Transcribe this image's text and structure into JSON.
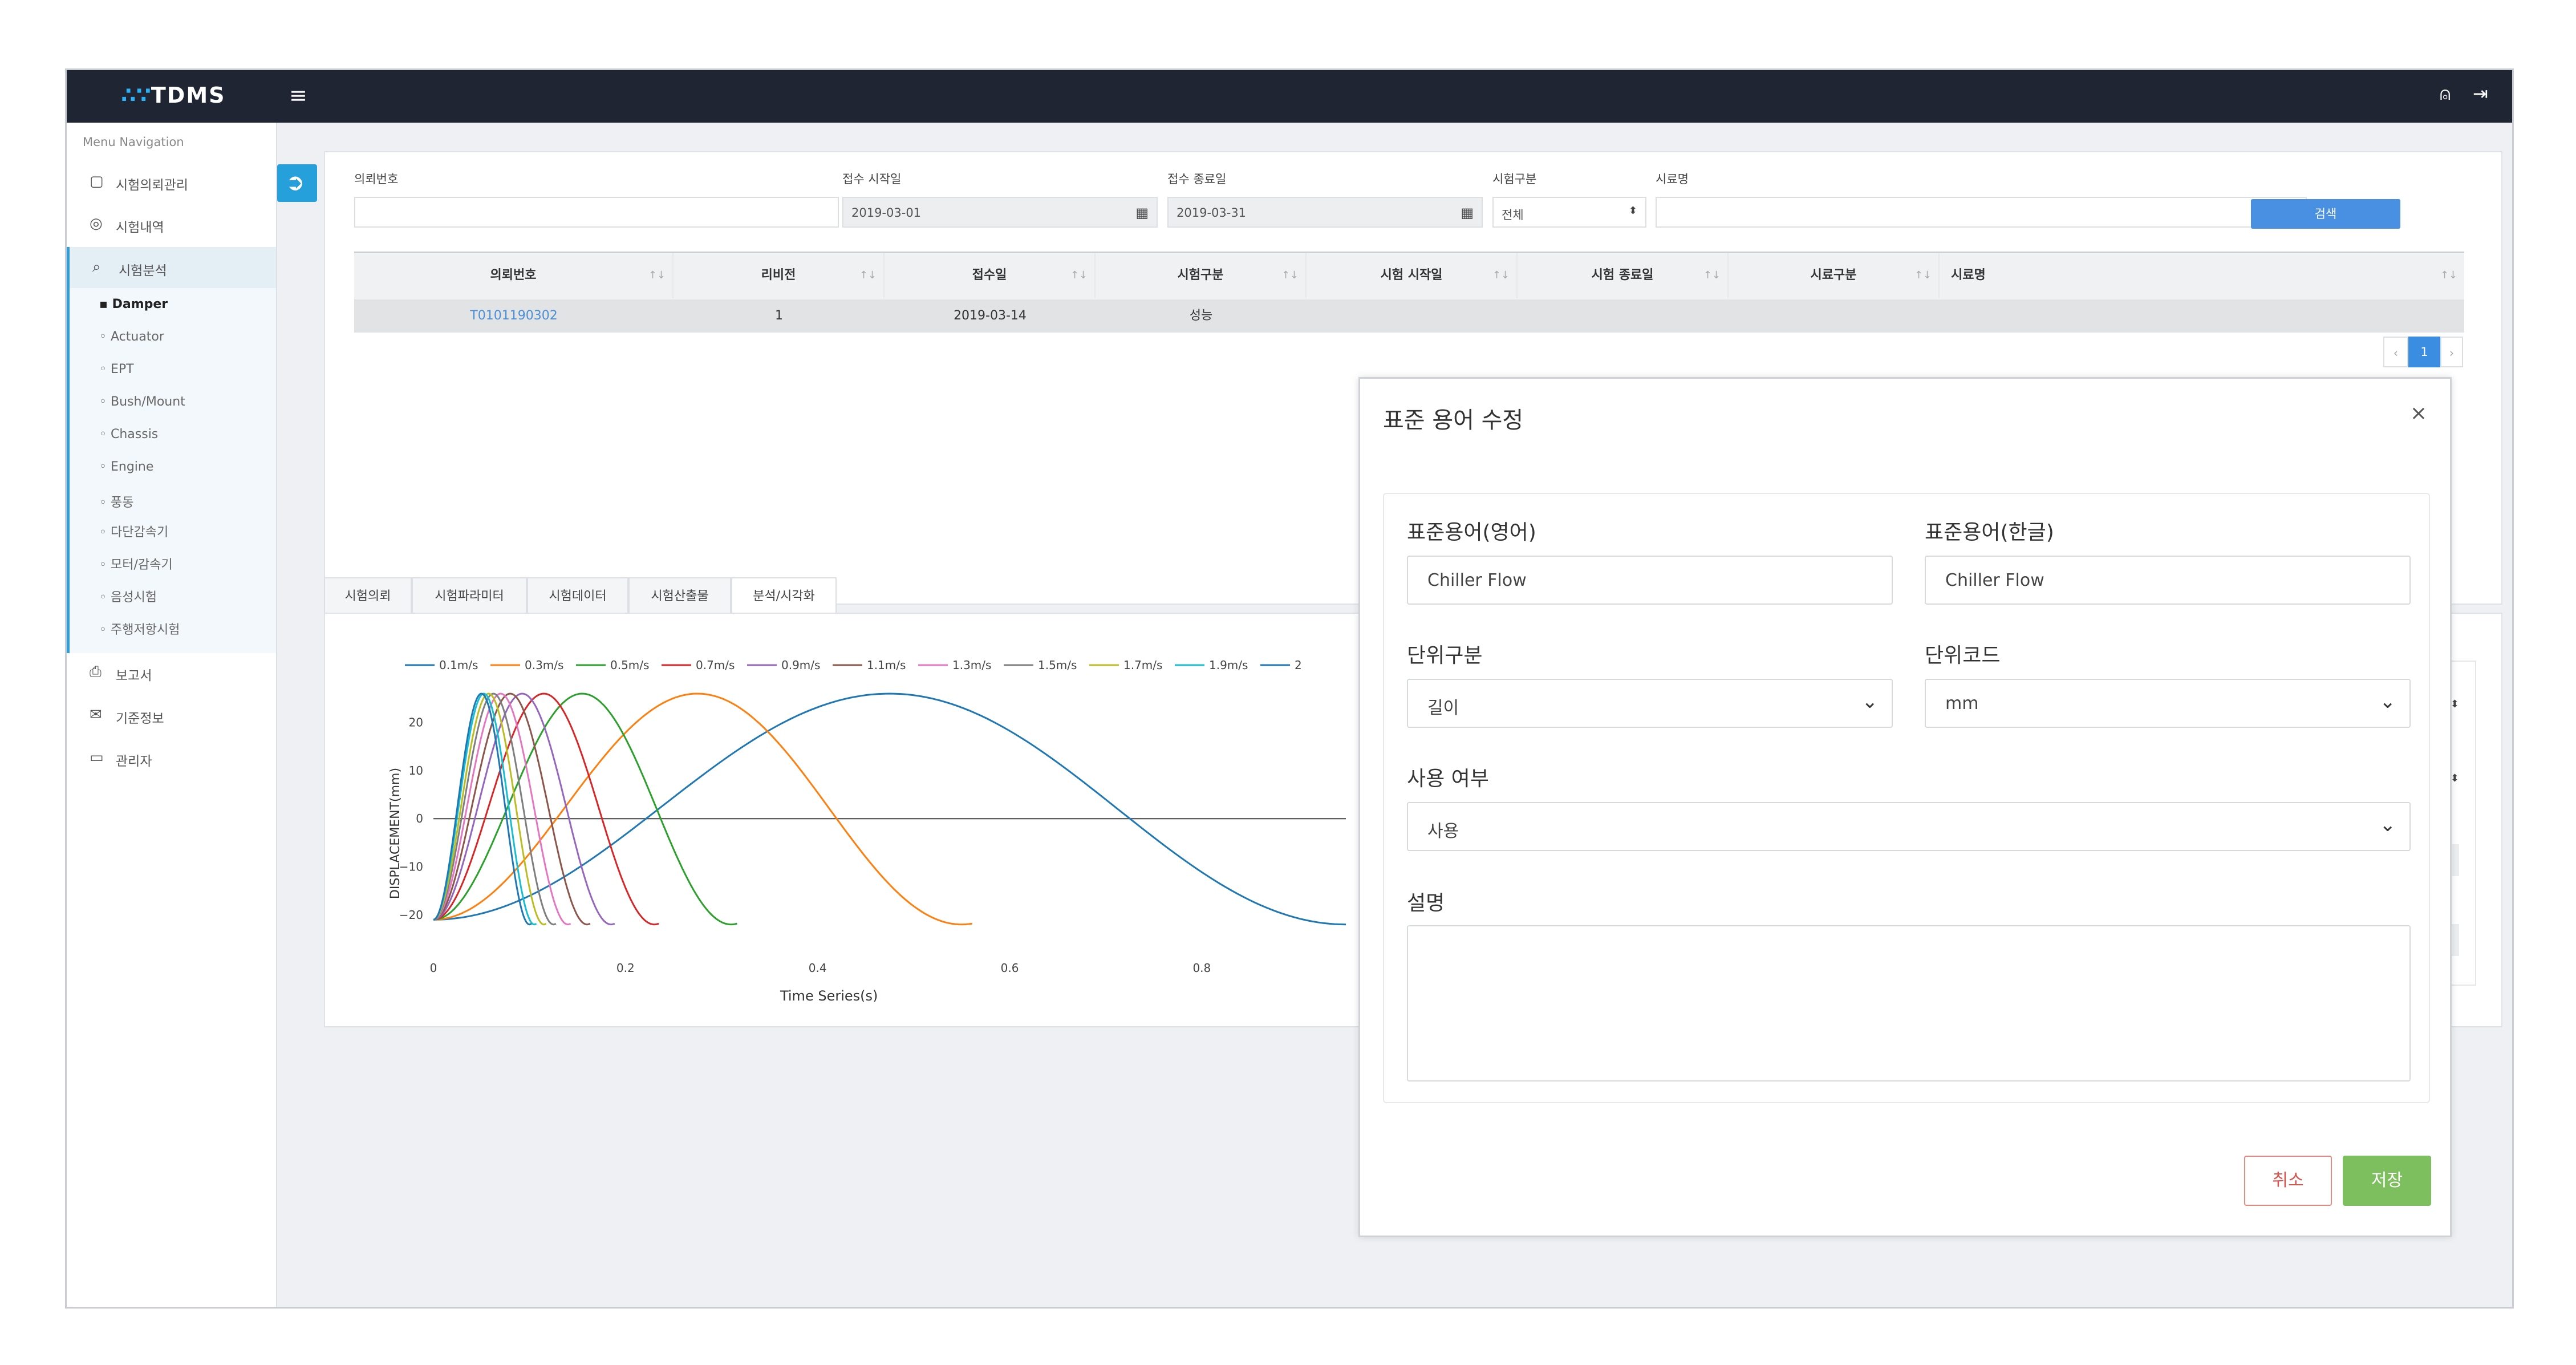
{
  "app": {
    "logo_dots": "∴∵",
    "logo_text": "TDMS",
    "menu_icon": "≡",
    "user_icon": "⍝",
    "logout_icon": "⇥"
  },
  "sidebar": {
    "title": "Menu Navigation",
    "items": [
      {
        "label": "시험의뢰관리",
        "icon": "▢"
      },
      {
        "label": "시험내역",
        "icon": "◎"
      },
      {
        "label": "시험분석",
        "icon": "⌕"
      },
      {
        "label": "보고서",
        "icon": "⎙"
      },
      {
        "label": "기준정보",
        "icon": "✉"
      },
      {
        "label": "관리자",
        "icon": "▭"
      }
    ],
    "subitems": [
      "Damper",
      "Actuator",
      "EPT",
      "Bush/Mount",
      "Chassis",
      "Engine",
      "풍동",
      "다단감속기",
      "모터/감속기",
      "음성시험",
      "주행저항시험"
    ]
  },
  "search": {
    "labels": {
      "request_no": "의뢰번호",
      "start": "접수 시작일",
      "end": "접수 종료일",
      "type": "시험구분",
      "sample": "시료명"
    },
    "start_value": "2019-03-01",
    "end_value": "2019-03-31",
    "type_value": "전체",
    "button": "검색"
  },
  "table": {
    "headers": [
      "의뢰번호",
      "리비전",
      "접수일",
      "시험구분",
      "시험 시작일",
      "시험 종료일",
      "시료구분",
      "시료명"
    ],
    "row": {
      "request_no": "T0101190302",
      "revision": "1",
      "date": "2019-03-14",
      "type": "성능"
    }
  },
  "pager": {
    "prev": "‹",
    "page": "1",
    "next": "›"
  },
  "tabs": [
    "시험의뢰",
    "시험파라미터",
    "시험데이터",
    "시험산출물",
    "분석/시각화"
  ],
  "chart_data": {
    "type": "line",
    "xlabel": "Time Series(s)",
    "ylabel": "DISPLACEMENT(mm)",
    "xlim": [
      0,
      0.95
    ],
    "ylim": [
      -25,
      26
    ],
    "xticks": [
      "0",
      "0.2",
      "0.4",
      "0.6",
      "0.8"
    ],
    "yticks": [
      "20",
      "10",
      "0",
      "−10",
      "−20"
    ],
    "legend_position": "top",
    "series": [
      {
        "name": "0.1m/s",
        "color": "#1f77b4"
      },
      {
        "name": "0.3m/s",
        "color": "#ff7f0e"
      },
      {
        "name": "0.5m/s",
        "color": "#2ca02c"
      },
      {
        "name": "0.7m/s",
        "color": "#d62728"
      },
      {
        "name": "0.9m/s",
        "color": "#9467bd"
      },
      {
        "name": "1.1m/s",
        "color": "#8c564b"
      },
      {
        "name": "1.3m/s",
        "color": "#e377c2"
      },
      {
        "name": "1.5m/s",
        "color": "#7f7f7f"
      },
      {
        "name": "1.7m/s",
        "color": "#bcbd22"
      },
      {
        "name": "1.9m/s",
        "color": "#17becf"
      },
      {
        "name": "2",
        "color": "#1f77b4"
      }
    ]
  },
  "modal": {
    "title": "표준 용어 수정",
    "close": "×",
    "en_label": "표준용어(영어)",
    "en_value": "Chiller Flow",
    "ko_label": "표준용어(한글)",
    "ko_value": "Chiller Flow",
    "unit_type_label": "단위구분",
    "unit_type_value": "길이",
    "unit_code_label": "단위코드",
    "unit_code_value": "mm",
    "use_label": "사용 여부",
    "use_value": "사용",
    "desc_label": "설명",
    "cancel": "취소",
    "save": "저장"
  }
}
